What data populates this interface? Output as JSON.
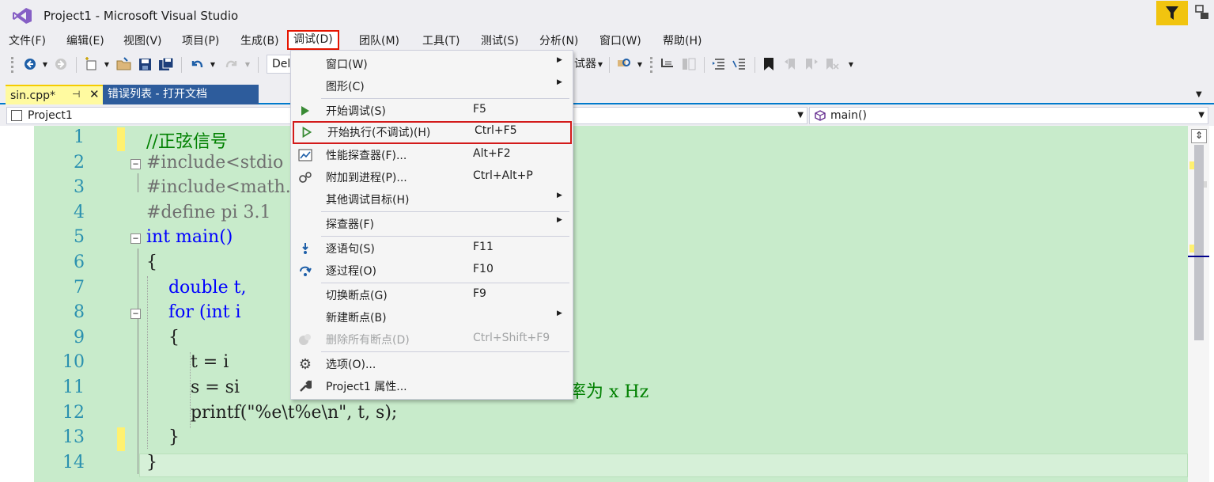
{
  "window": {
    "title": "Project1 - Microsoft Visual Studio"
  },
  "menubar": [
    {
      "label": "文件(F)"
    },
    {
      "label": "编辑(E)"
    },
    {
      "label": "视图(V)"
    },
    {
      "label": "项目(P)"
    },
    {
      "label": "生成(B)"
    },
    {
      "label": "调试(D)",
      "active": true
    },
    {
      "label": "团队(M)"
    },
    {
      "label": "工具(T)"
    },
    {
      "label": "测试(S)"
    },
    {
      "label": "分析(N)"
    },
    {
      "label": "窗口(W)"
    },
    {
      "label": "帮助(H)"
    }
  ],
  "toolbar": {
    "config_combo": "Del",
    "debugger_label": "试器"
  },
  "tabs": [
    {
      "label": "sin.cpp*",
      "active": true,
      "pinned": true
    },
    {
      "label": "错误列表 - 打开文档",
      "active": false
    }
  ],
  "navbar": {
    "project": "Project1",
    "member": "main()"
  },
  "editor": {
    "lines": [
      {
        "n": "1",
        "text": "//正弦信号"
      },
      {
        "n": "2",
        "text": "#include<stdio"
      },
      {
        "n": "3",
        "text": "#include<math."
      },
      {
        "n": "4",
        "text": "#define pi 3.1"
      },
      {
        "n": "5",
        "text": "int main()"
      },
      {
        "n": "6",
        "text": "{"
      },
      {
        "n": "7",
        "text": "    double t,"
      },
      {
        "n": "8",
        "text": "    for (int i"
      },
      {
        "n": "9",
        "text": "    {"
      },
      {
        "n": "10",
        "text": "        t = i"
      },
      {
        "n": "11",
        "text": "        s = si",
        "tail": "率为 x Hz"
      },
      {
        "n": "12",
        "text": "        printf(\"%e\\t%e\\n\", t, s);"
      },
      {
        "n": "13",
        "text": "    }"
      },
      {
        "n": "14",
        "text": "}"
      }
    ]
  },
  "debug_menu": {
    "items": [
      {
        "label": "窗口(W)",
        "shortcut": "",
        "submenu": true,
        "icon": ""
      },
      {
        "label": "图形(C)",
        "shortcut": "",
        "submenu": true,
        "icon": ""
      },
      {
        "label": "开始调试(S)",
        "shortcut": "F5",
        "submenu": false,
        "icon": "play-filled-icon"
      },
      {
        "label": "开始执行(不调试)(H)",
        "shortcut": "Ctrl+F5",
        "submenu": false,
        "icon": "play-outline-icon",
        "highlighted": true
      },
      {
        "label": "性能探查器(F)...",
        "shortcut": "Alt+F2",
        "submenu": false,
        "icon": "performance-icon"
      },
      {
        "label": "附加到进程(P)...",
        "shortcut": "Ctrl+Alt+P",
        "submenu": false,
        "icon": "attach-process-icon"
      },
      {
        "label": "其他调试目标(H)",
        "shortcut": "",
        "submenu": true,
        "icon": ""
      },
      {
        "label": "探查器(F)",
        "shortcut": "",
        "submenu": true,
        "icon": ""
      },
      {
        "label": "逐语句(S)",
        "shortcut": "F11",
        "submenu": false,
        "icon": "step-into-icon"
      },
      {
        "label": "逐过程(O)",
        "shortcut": "F10",
        "submenu": false,
        "icon": "step-over-icon"
      },
      {
        "label": "切换断点(G)",
        "shortcut": "F9",
        "submenu": false,
        "icon": ""
      },
      {
        "label": "新建断点(B)",
        "shortcut": "",
        "submenu": true,
        "icon": ""
      },
      {
        "label": "删除所有断点(D)",
        "shortcut": "Ctrl+Shift+F9",
        "submenu": false,
        "icon": "delete-breakpoints-icon",
        "disabled": true
      },
      {
        "label": "选项(O)...",
        "shortcut": "",
        "submenu": false,
        "icon": "gear-icon"
      },
      {
        "label": "Project1 属性...",
        "shortcut": "",
        "submenu": false,
        "icon": "wrench-icon"
      }
    ]
  },
  "colors": {
    "accent": "#007acc",
    "highlight_border": "#e51400",
    "code_background": "#c8ebcb",
    "line_number": "#2b91af",
    "notification": "#f1c40f"
  }
}
